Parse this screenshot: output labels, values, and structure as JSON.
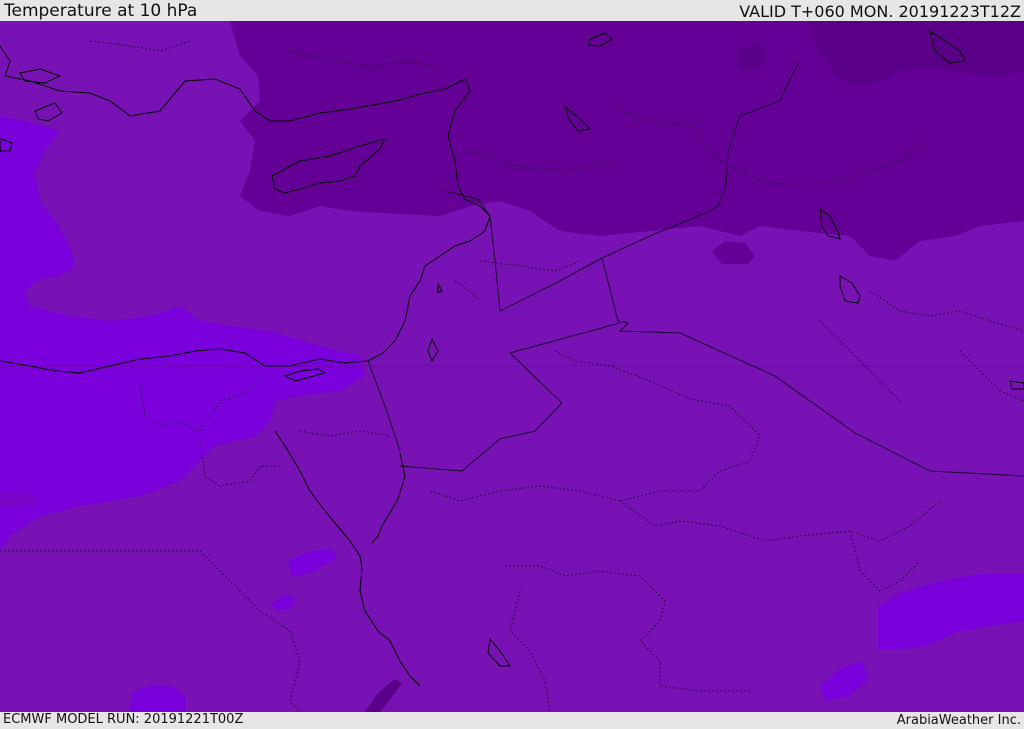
{
  "header": {
    "title": "Temperature at 10 hPa",
    "valid": "VALID T+060 MON. 20191223T12Z"
  },
  "footer": {
    "model_run": "ECMWF MODEL RUN: 20191221T00Z",
    "credit": "ArabiaWeather Inc."
  },
  "colors": {
    "base": "#7812b4",
    "warm_band": "#6c0aa6",
    "dark_band": "#640096",
    "darkest": "#5a0088",
    "bright": "#7a00dc",
    "mid_bright": "#7805c8",
    "coast": "#000000",
    "border": "#1a0030"
  }
}
